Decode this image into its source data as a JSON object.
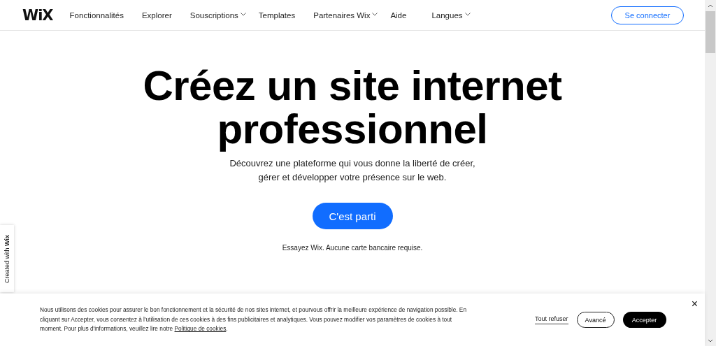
{
  "header": {
    "logo": "WiX",
    "nav": [
      {
        "label": "Fonctionnalités",
        "dropdown": false
      },
      {
        "label": "Explorer",
        "dropdown": false
      },
      {
        "label": "Souscriptions",
        "dropdown": true
      },
      {
        "label": "Templates",
        "dropdown": false
      },
      {
        "label": "Partenaires Wix",
        "dropdown": true
      },
      {
        "label": "Aide",
        "dropdown": false
      },
      {
        "label": "Langues",
        "dropdown": true
      }
    ],
    "login": "Se connecter"
  },
  "hero": {
    "title_lines": [
      "Créez un site internet",
      "professionnel"
    ],
    "subtitle_lines": [
      "Découvrez une plateforme qui vous donne la liberté de créer,",
      "gérer et développer votre présence sur le web."
    ],
    "cta": "C'est parti",
    "note": "Essayez Wix. Aucune carte bancaire requise."
  },
  "side_tab": "Created with **Wix**",
  "cookie": {
    "text": "Nous utilisons des cookies pour assurer le bon fonctionnement et la sécurité de nos sites internet, et pourvous offrir la meilleure expérience de navigation possible. En cliquant sur Accepter, vous consentez à l'utilisation de ces cookies à des fins publicitaires et analytiques. Vous pouvez modifier vos paramètres de cookies à tout moment. Pour plus d'informations, veuillez lire notre ",
    "link": "Politique de cookies",
    "text_end": ".",
    "refuse": "Tout refuser",
    "advanced": "Avancé",
    "accept": "Accepter",
    "close": "×"
  }
}
